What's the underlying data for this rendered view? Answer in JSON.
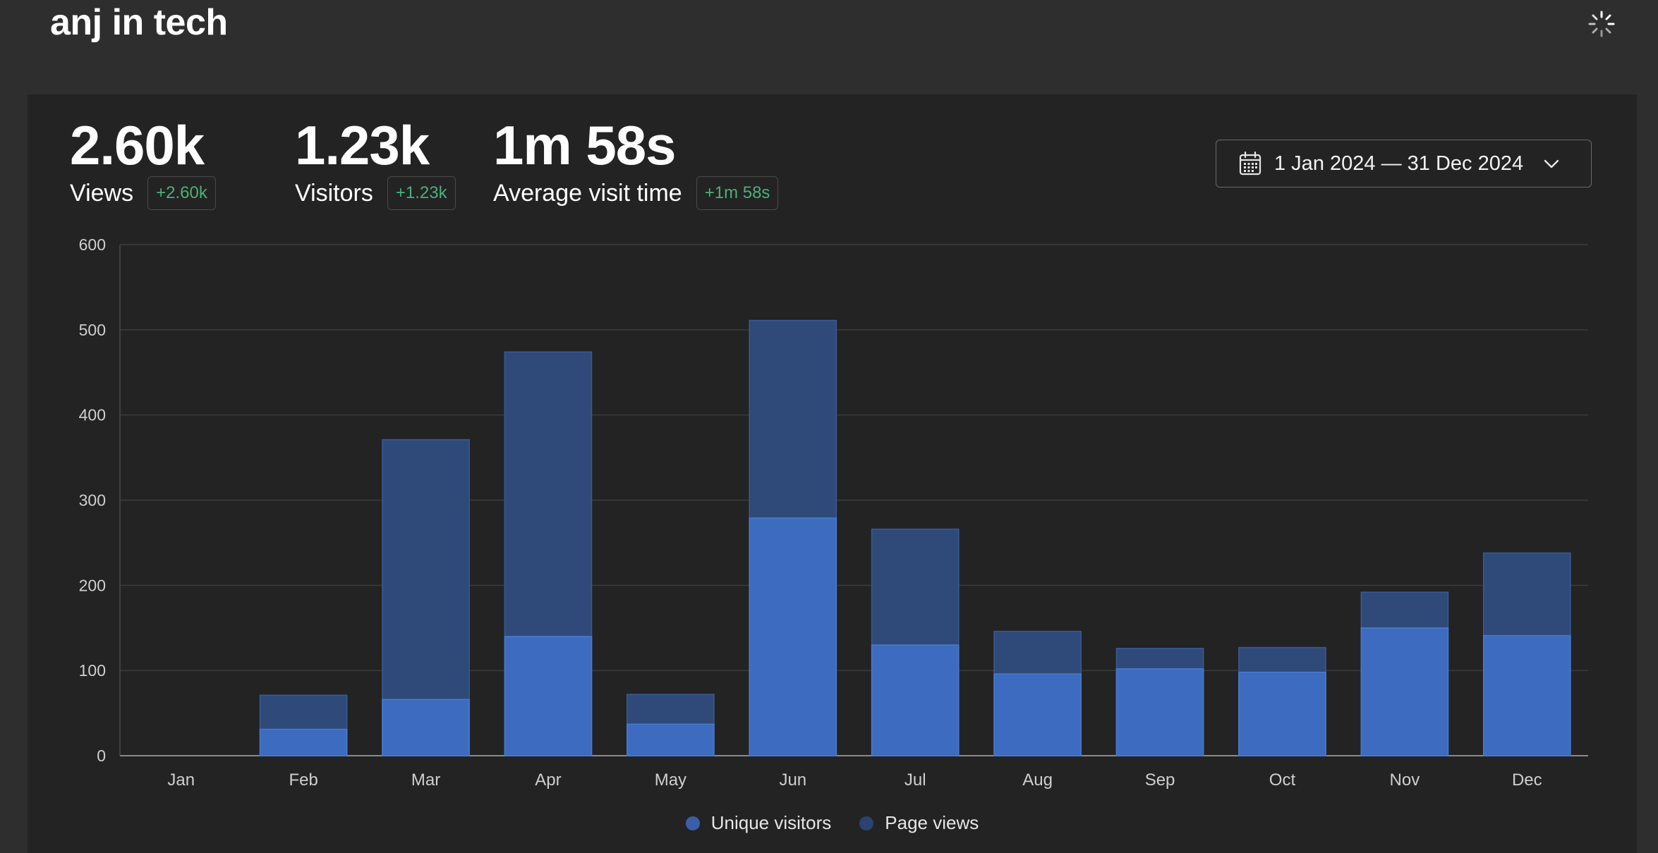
{
  "header": {
    "title": "anj in tech"
  },
  "stats": [
    {
      "value": "2.60k",
      "label": "Views",
      "delta": "+2.60k"
    },
    {
      "value": "1.23k",
      "label": "Visitors",
      "delta": "+1.23k"
    },
    {
      "value": "1m 58s",
      "label": "Average visit time",
      "delta": "+1m 58s"
    }
  ],
  "date_range": {
    "label": "1 Jan 2024 — 31 Dec 2024"
  },
  "colors": {
    "unique_visitors": "#3d6bbf",
    "page_views": "#2f4a78",
    "delta_green": "#4caf7a",
    "grid": "#3c3c3c"
  },
  "chart_data": {
    "type": "bar",
    "stacked": "overlay",
    "categories": [
      "Jan",
      "Feb",
      "Mar",
      "Apr",
      "May",
      "Jun",
      "Jul",
      "Aug",
      "Sep",
      "Oct",
      "Nov",
      "Dec"
    ],
    "series": [
      {
        "name": "Unique visitors",
        "values": [
          0,
          31,
          66,
          140,
          37,
          279,
          130,
          96,
          102,
          98,
          150,
          141
        ]
      },
      {
        "name": "Page views",
        "values": [
          0,
          71,
          371,
          474,
          72,
          511,
          266,
          146,
          126,
          127,
          192,
          238
        ]
      }
    ],
    "ylim": [
      0,
      600
    ],
    "yticks": [
      0,
      100,
      200,
      300,
      400,
      500,
      600
    ],
    "grid": true,
    "legend": "bottom-center"
  }
}
